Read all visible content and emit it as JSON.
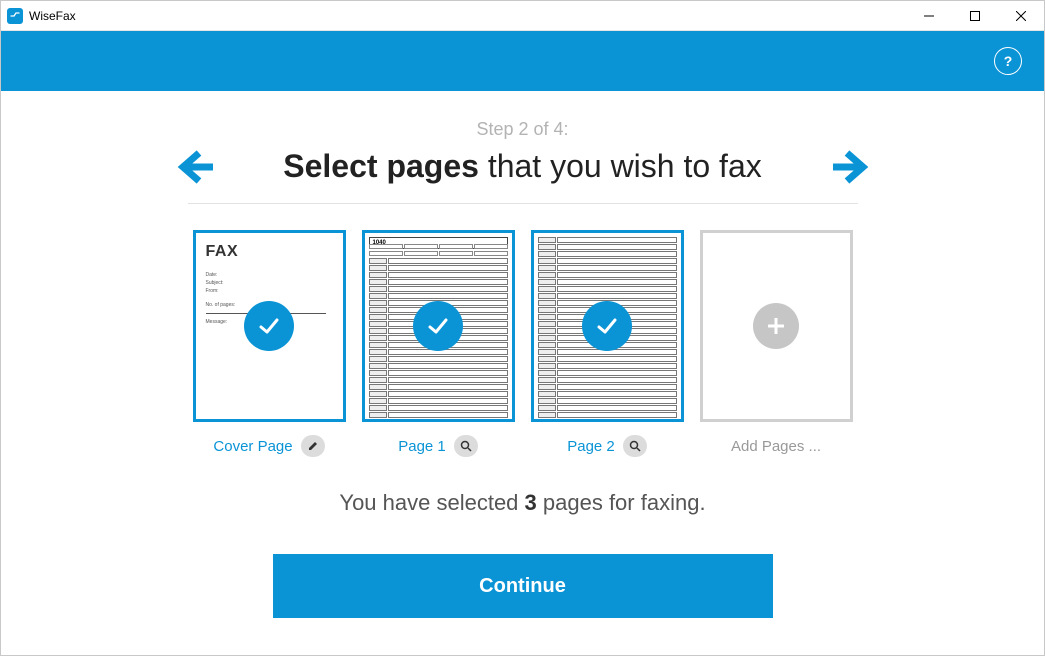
{
  "window": {
    "title": "WiseFax"
  },
  "header": {
    "help_tooltip": "?"
  },
  "wizard": {
    "step_text": "Step 2 of 4:",
    "title_bold": "Select pages",
    "title_rest": " that you wish to fax"
  },
  "pages": [
    {
      "label": "Cover Page",
      "type": "cover",
      "selected": true,
      "action_icon": "edit"
    },
    {
      "label": "Page 1",
      "type": "form",
      "selected": true,
      "action_icon": "zoom",
      "form_header": "1040"
    },
    {
      "label": "Page 2",
      "type": "form",
      "selected": true,
      "action_icon": "zoom"
    },
    {
      "label": "Add Pages ...",
      "type": "add",
      "selected": false
    }
  ],
  "cover_preview": {
    "heading": "FAX",
    "fields": [
      "Date:",
      "Subject:",
      "From:",
      "",
      "No. of pages:",
      "",
      "Message:"
    ]
  },
  "summary": {
    "prefix": "You have selected ",
    "count": "3",
    "suffix": " pages for faxing."
  },
  "buttons": {
    "continue": "Continue"
  }
}
